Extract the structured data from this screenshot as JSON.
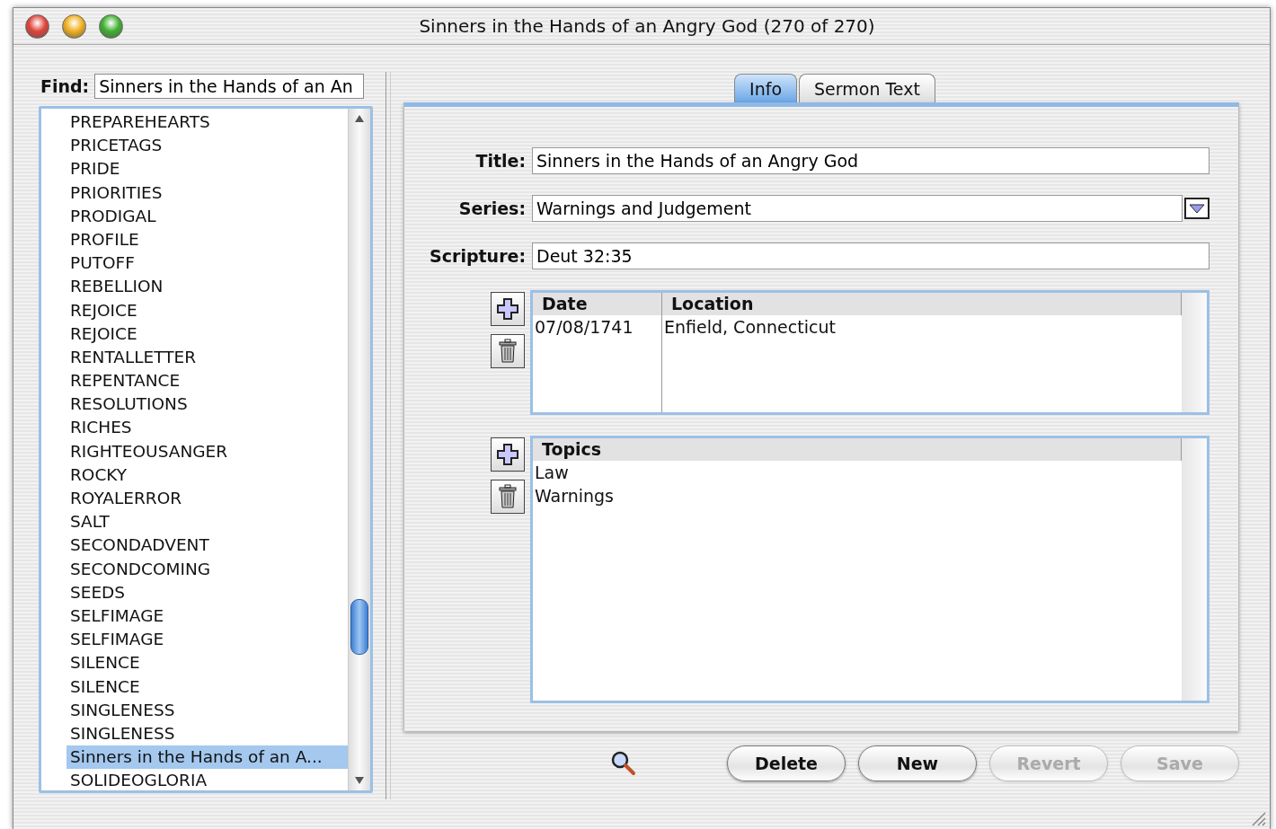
{
  "window": {
    "title": "Sinners in the Hands of an Angry God (270 of 270)"
  },
  "find": {
    "label": "Find:",
    "value": "Sinners in the Hands of an An"
  },
  "list": {
    "items": [
      {
        "label": "PREPAREHEARTS",
        "selected": false
      },
      {
        "label": "PRICETAGS",
        "selected": false
      },
      {
        "label": "PRIDE",
        "selected": false
      },
      {
        "label": "PRIORITIES",
        "selected": false
      },
      {
        "label": "PRODIGAL",
        "selected": false
      },
      {
        "label": "PROFILE",
        "selected": false
      },
      {
        "label": "PUTOFF",
        "selected": false
      },
      {
        "label": "REBELLION",
        "selected": false
      },
      {
        "label": "REJOICE",
        "selected": false
      },
      {
        "label": "REJOICE",
        "selected": false
      },
      {
        "label": "RENTALLETTER",
        "selected": false
      },
      {
        "label": "REPENTANCE",
        "selected": false
      },
      {
        "label": "RESOLUTIONS",
        "selected": false
      },
      {
        "label": "RICHES",
        "selected": false
      },
      {
        "label": "RIGHTEOUSANGER",
        "selected": false
      },
      {
        "label": "ROCKY",
        "selected": false
      },
      {
        "label": "ROYALERROR",
        "selected": false
      },
      {
        "label": "SALT",
        "selected": false
      },
      {
        "label": "SECONDADVENT",
        "selected": false
      },
      {
        "label": "SECONDCOMING",
        "selected": false
      },
      {
        "label": "SEEDS",
        "selected": false
      },
      {
        "label": "SELFIMAGE",
        "selected": false
      },
      {
        "label": "SELFIMAGE",
        "selected": false
      },
      {
        "label": "SILENCE",
        "selected": false
      },
      {
        "label": "SILENCE",
        "selected": false
      },
      {
        "label": "SINGLENESS",
        "selected": false
      },
      {
        "label": "SINGLENESS",
        "selected": false
      },
      {
        "label": "Sinners in the Hands of an A...",
        "selected": true
      },
      {
        "label": "SOLIDEOGLORIA",
        "selected": false
      }
    ]
  },
  "tabs": [
    {
      "label": "Info",
      "selected": true
    },
    {
      "label": "Sermon Text",
      "selected": false
    }
  ],
  "form": [
    {
      "kind": "text",
      "label": "Title:",
      "value": "Sinners in the Hands of an Angry God"
    },
    {
      "kind": "combo",
      "label": "Series:",
      "value": "Warnings and Judgement"
    },
    {
      "kind": "text",
      "label": "Scripture:",
      "value": "Deut 32:35"
    }
  ],
  "deliveries": {
    "columns": [
      "Date",
      "Location"
    ],
    "rows": [
      [
        "07/08/1741",
        "Enfield, Connecticut"
      ]
    ]
  },
  "topics": {
    "columns": [
      "Topics"
    ],
    "rows": [
      [
        "Law"
      ],
      [
        "Warnings"
      ]
    ]
  },
  "buttons": [
    {
      "label": "Delete",
      "disabled": false
    },
    {
      "label": "New",
      "disabled": false
    },
    {
      "label": "Revert",
      "disabled": true
    },
    {
      "label": "Save",
      "disabled": true
    }
  ]
}
